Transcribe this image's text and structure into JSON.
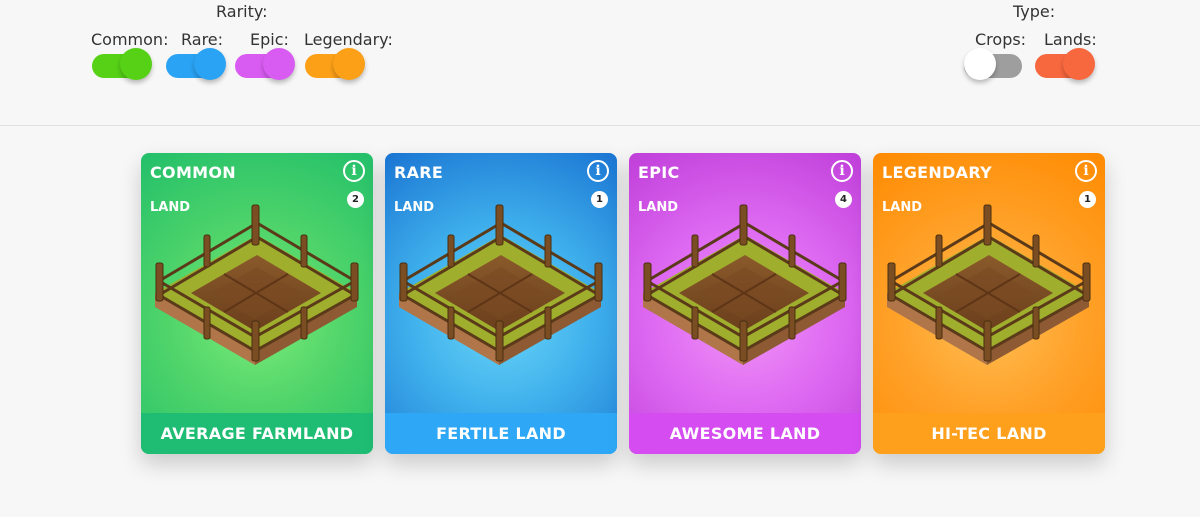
{
  "filters": {
    "rarity": {
      "title": "Rarity:",
      "toggles": [
        {
          "label": "Common:",
          "color": "#56d116",
          "state": "on"
        },
        {
          "label": "Rare:",
          "color": "#2ba3f4",
          "state": "on"
        },
        {
          "label": "Epic:",
          "color": "#d95cf2",
          "state": "on"
        },
        {
          "label": "Legendary:",
          "color": "#fca018",
          "state": "on"
        }
      ]
    },
    "type": {
      "title": "Type:",
      "toggles": [
        {
          "label": "Crops:",
          "color": "#9e9e9e",
          "state": "off"
        },
        {
          "label": "Lands:",
          "color": "#f7683f",
          "state": "on"
        }
      ]
    }
  },
  "cards": [
    {
      "rarity": "COMMON",
      "type": "LAND",
      "count": "2",
      "name": "AVERAGE FARMLAND",
      "icon": "info-icon",
      "colors": {
        "top": "#2ac46c",
        "mid": "#6ce36e",
        "footer": "#1fbd73"
      }
    },
    {
      "rarity": "RARE",
      "type": "LAND",
      "count": "1",
      "name": "FERTILE LAND",
      "icon": "info-icon",
      "colors": {
        "top": "#1a74d2",
        "mid": "#56c8f4",
        "footer": "#2ea8f6"
      }
    },
    {
      "rarity": "EPIC",
      "type": "LAND",
      "count": "4",
      "name": "AWESOME LAND",
      "icon": "info-icon",
      "colors": {
        "top": "#bf3ed9",
        "mid": "#ed86f6",
        "footer": "#d54cf1"
      }
    },
    {
      "rarity": "LEGENDARY",
      "type": "LAND",
      "count": "1",
      "name": "HI-TEC LAND",
      "icon": "info-icon",
      "colors": {
        "top": "#ff8a00",
        "mid": "#ffb13b",
        "footer": "#ffa01c"
      }
    }
  ]
}
